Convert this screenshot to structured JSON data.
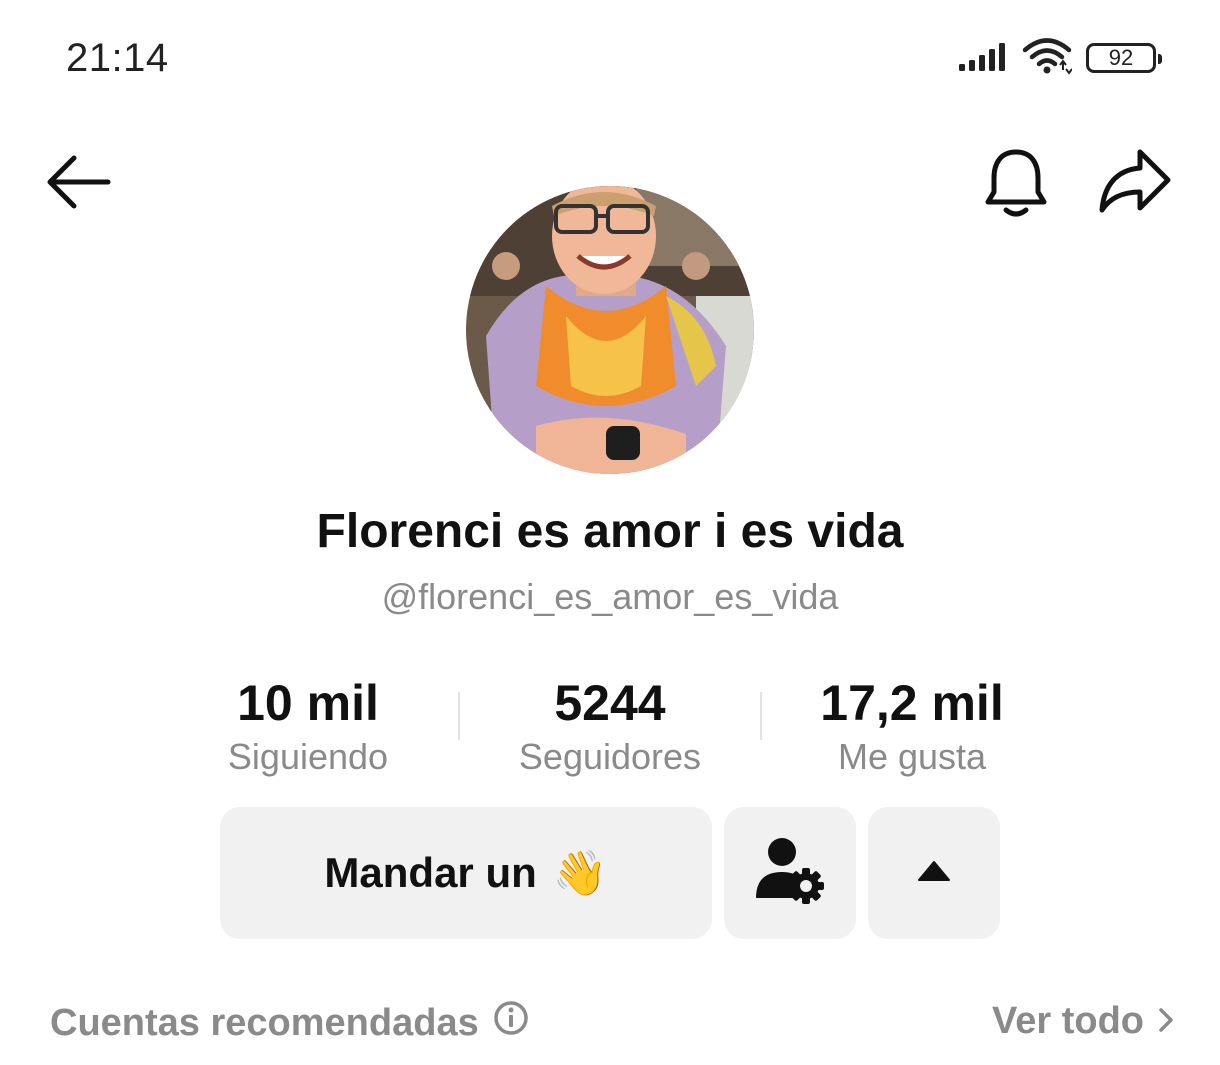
{
  "status_bar": {
    "time": "21:14",
    "battery": "92",
    "icons": [
      "signal-icon",
      "wifi-icon",
      "battery-icon"
    ]
  },
  "nav": {
    "icons": [
      "back-arrow-icon",
      "bell-icon",
      "share-icon"
    ]
  },
  "profile": {
    "display_name": "Florenci es amor i es vida",
    "username": "@florenci_es_amor_es_vida"
  },
  "stats": [
    {
      "value": "10 mil",
      "label": "Siguiendo"
    },
    {
      "value": "5244",
      "label": "Seguidores"
    },
    {
      "value": "17,2 mil",
      "label": "Me gusta"
    }
  ],
  "actions": {
    "message_label": "Mandar un",
    "message_emoji": "👋",
    "icons": [
      "user-settings-icon",
      "caret-up-icon"
    ]
  },
  "recommended": {
    "title": "Cuentas recomendadas",
    "see_all": "Ver todo"
  },
  "colors": {
    "text_primary": "#111111",
    "text_secondary": "#8a8a8a",
    "button_bg": "#f1f1f1",
    "divider": "#e2e2e2"
  }
}
